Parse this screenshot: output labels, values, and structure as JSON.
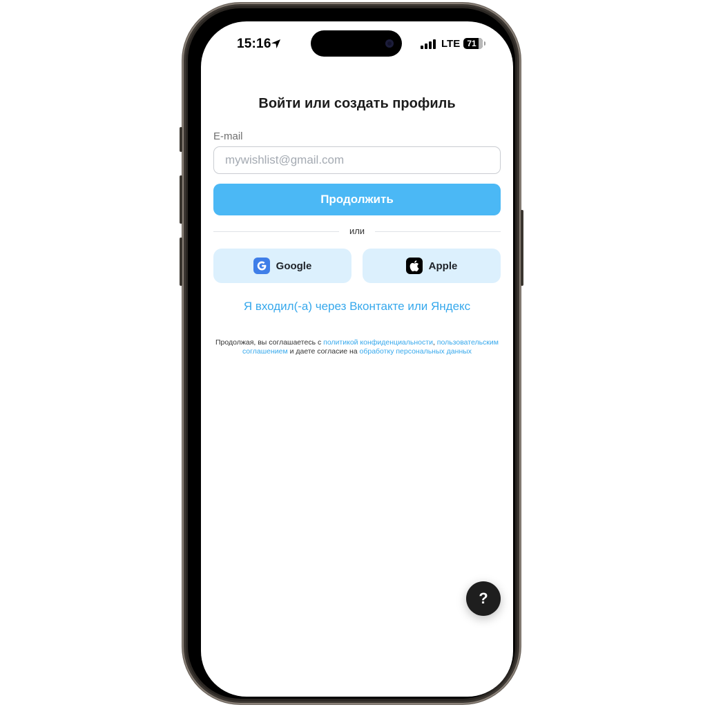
{
  "status_bar": {
    "time": "15:16",
    "network": "LTE",
    "battery": "71"
  },
  "auth": {
    "title": "Войти или создать профиль",
    "email_label": "E-mail",
    "email_placeholder": "mywishlist@gmail.com",
    "continue_label": "Продолжить",
    "divider_text": "или",
    "google_label": "Google",
    "apple_label": "Apple",
    "vk_yandex_link": "Я входил(-а) через Вконтакте или Яндекс"
  },
  "legal": {
    "prefix": "Продолжая, вы соглашаетесь с ",
    "privacy_link": "политикой конфиденциальности",
    "sep": ", ",
    "terms_link": "пользовательским соглашением",
    "middle": " и даете согласие на ",
    "data_link": "обработку персональных данных"
  },
  "help_button": "?",
  "colors": {
    "accent": "#4bb8f5",
    "link": "#36a8ec",
    "social_bg": "#dcf0fd"
  },
  "icons": [
    "location-arrow-icon",
    "signal-icon",
    "battery-icon",
    "google-icon",
    "apple-icon"
  ]
}
